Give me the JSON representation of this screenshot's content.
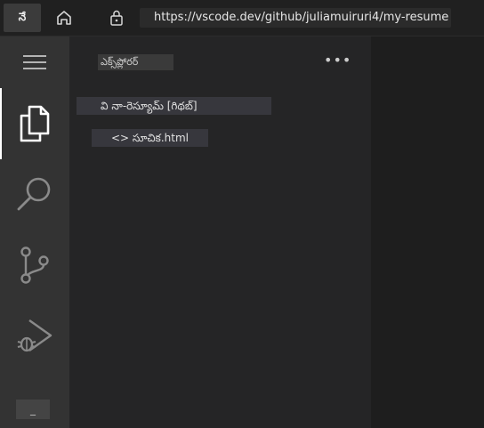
{
  "browser": {
    "tab_label": "నే",
    "url": "https://vscode.dev/github/juliamuiruri4/my-resume",
    "icons": {
      "home": "home-icon",
      "lock": "lock-icon"
    }
  },
  "activity_bar": {
    "menu_icon": "hamburger-menu-icon",
    "items": [
      {
        "name": "explorer",
        "icon": "files-icon",
        "active": true
      },
      {
        "name": "search",
        "icon": "search-icon",
        "active": false
      },
      {
        "name": "source-control",
        "icon": "source-control-icon",
        "active": false
      },
      {
        "name": "run-and-debug",
        "icon": "run-debug-icon",
        "active": false
      }
    ],
    "bottom_label": "_"
  },
  "sidebar": {
    "title": "ఎక్స్‌ప్లోరర్",
    "more_label": "•••",
    "repo_label": "వి నా-రెస్యూమ్ [గిథబ్]",
    "file_label": "<> సూచిక.html"
  },
  "colors": {
    "activity_bar": "#333333",
    "sidebar": "#252526",
    "editor": "#1e1e1e",
    "browser_bar": "#202020",
    "row_highlight": "#37373d"
  }
}
